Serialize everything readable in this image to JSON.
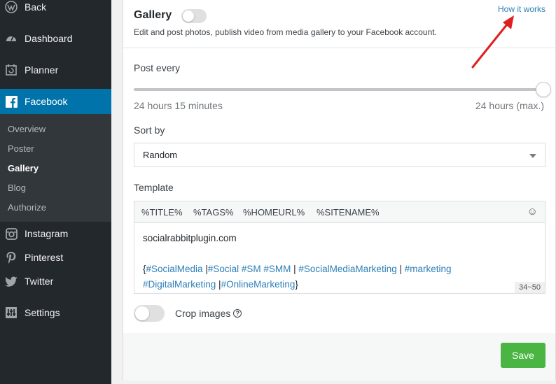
{
  "sidebar": {
    "back": {
      "label": "Back",
      "icon": "wordpress-icon"
    },
    "items": [
      {
        "label": "Dashboard",
        "icon": "dashboard-icon"
      },
      {
        "label": "Planner",
        "icon": "calendar-icon"
      },
      {
        "label": "Facebook",
        "icon": "facebook-icon"
      },
      {
        "label": "Instagram",
        "icon": "instagram-icon"
      },
      {
        "label": "Pinterest",
        "icon": "pinterest-icon"
      },
      {
        "label": "Twitter",
        "icon": "twitter-icon"
      },
      {
        "label": "Settings",
        "icon": "settings-icon"
      }
    ],
    "submenu": [
      "Overview",
      "Poster",
      "Gallery",
      "Blog",
      "Authorize"
    ],
    "current_submenu": "Gallery"
  },
  "header": {
    "title": "Gallery",
    "description": "Edit and post photos, publish video from media gallery to your Facebook account.",
    "how_link": "How it works",
    "enabled": false
  },
  "post_every": {
    "label": "Post every",
    "current_value": "24 hours 15 minutes",
    "max_value": "24 hours (max.)"
  },
  "sort_by": {
    "label": "Sort by",
    "selected": "Random"
  },
  "template": {
    "label": "Template",
    "tags": [
      "%TITLE%",
      "%TAGS%",
      "%HOMEURL%",
      "%SITENAME%"
    ],
    "line1": "socialrabbitplugin.com",
    "spin_parts": [
      "{",
      "#SocialMedia",
      " |",
      "#Social #SM #SMM",
      " | ",
      "#SocialMediaMarketing",
      " | ",
      "#marketing",
      "#DigitalMarketing",
      " |",
      "#OnlineMarketing",
      "}"
    ],
    "counter": "34~50"
  },
  "crop": {
    "label": "Crop images",
    "enabled": false
  },
  "save_label": "Save",
  "colors": {
    "sidebar_bg": "#23282d",
    "active": "#0073aa",
    "link": "#2e7fb8",
    "save": "#4bb543",
    "arrow": "#e02020"
  }
}
